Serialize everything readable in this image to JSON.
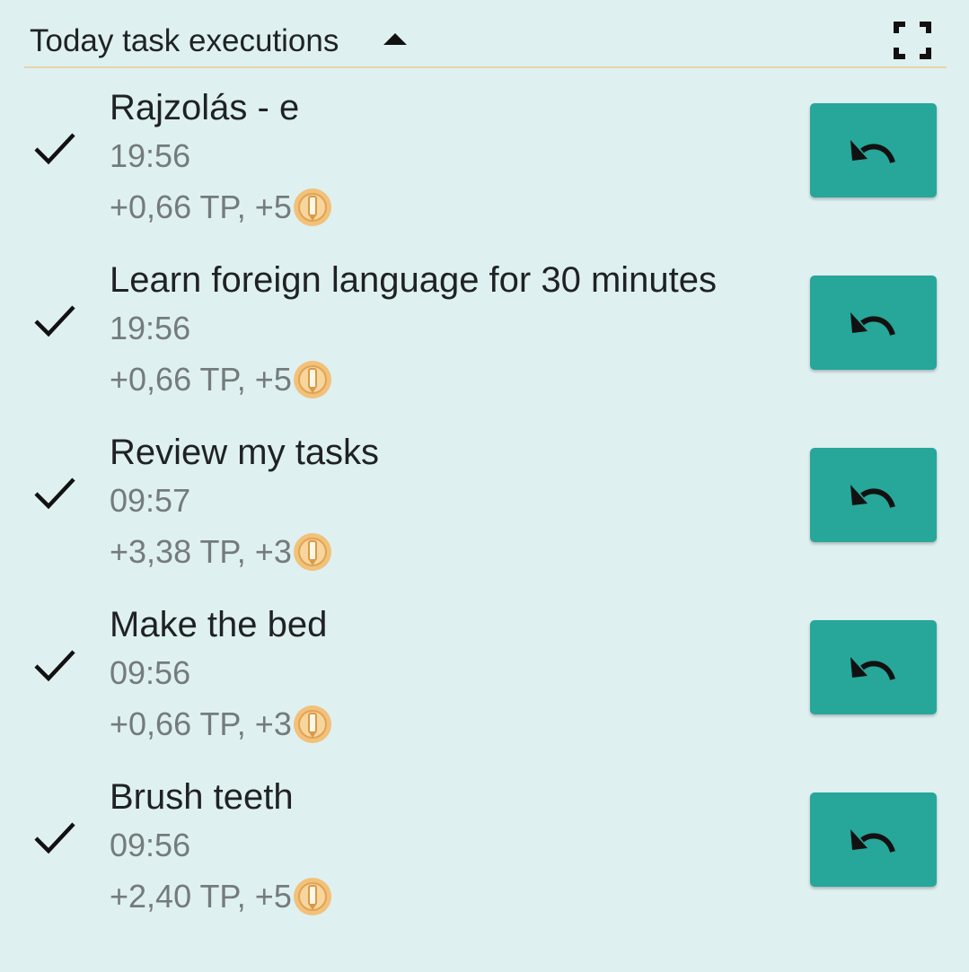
{
  "header": {
    "title": "Today task executions",
    "collapse_icon": "caret-up-icon",
    "fullscreen_icon": "fullscreen-icon"
  },
  "colors": {
    "background": "#dff0f0",
    "accent_button": "#27a69a",
    "divider": "#e6d4a6",
    "primary_text": "#1f2224",
    "secondary_text": "#747b7d",
    "coin": "#f2c17a"
  },
  "tasks": [
    {
      "title": "Rajzolás - e",
      "time": "19:56",
      "reward": "+0,66 TP, +5",
      "status_icon": "check-icon",
      "coin_icon": "coin-icon",
      "action_icon": "undo-icon"
    },
    {
      "title": "Learn foreign language for 30 minutes",
      "time": "19:56",
      "reward": "+0,66 TP, +5",
      "status_icon": "check-icon",
      "coin_icon": "coin-icon",
      "action_icon": "undo-icon"
    },
    {
      "title": "Review my tasks",
      "time": "09:57",
      "reward": "+3,38 TP, +3",
      "status_icon": "check-icon",
      "coin_icon": "coin-icon",
      "action_icon": "undo-icon"
    },
    {
      "title": "Make the bed",
      "time": "09:56",
      "reward": "+0,66 TP, +3",
      "status_icon": "check-icon",
      "coin_icon": "coin-icon",
      "action_icon": "undo-icon"
    },
    {
      "title": "Brush teeth",
      "time": "09:56",
      "reward": "+2,40 TP, +5",
      "status_icon": "check-icon",
      "coin_icon": "coin-icon",
      "action_icon": "undo-icon"
    }
  ]
}
